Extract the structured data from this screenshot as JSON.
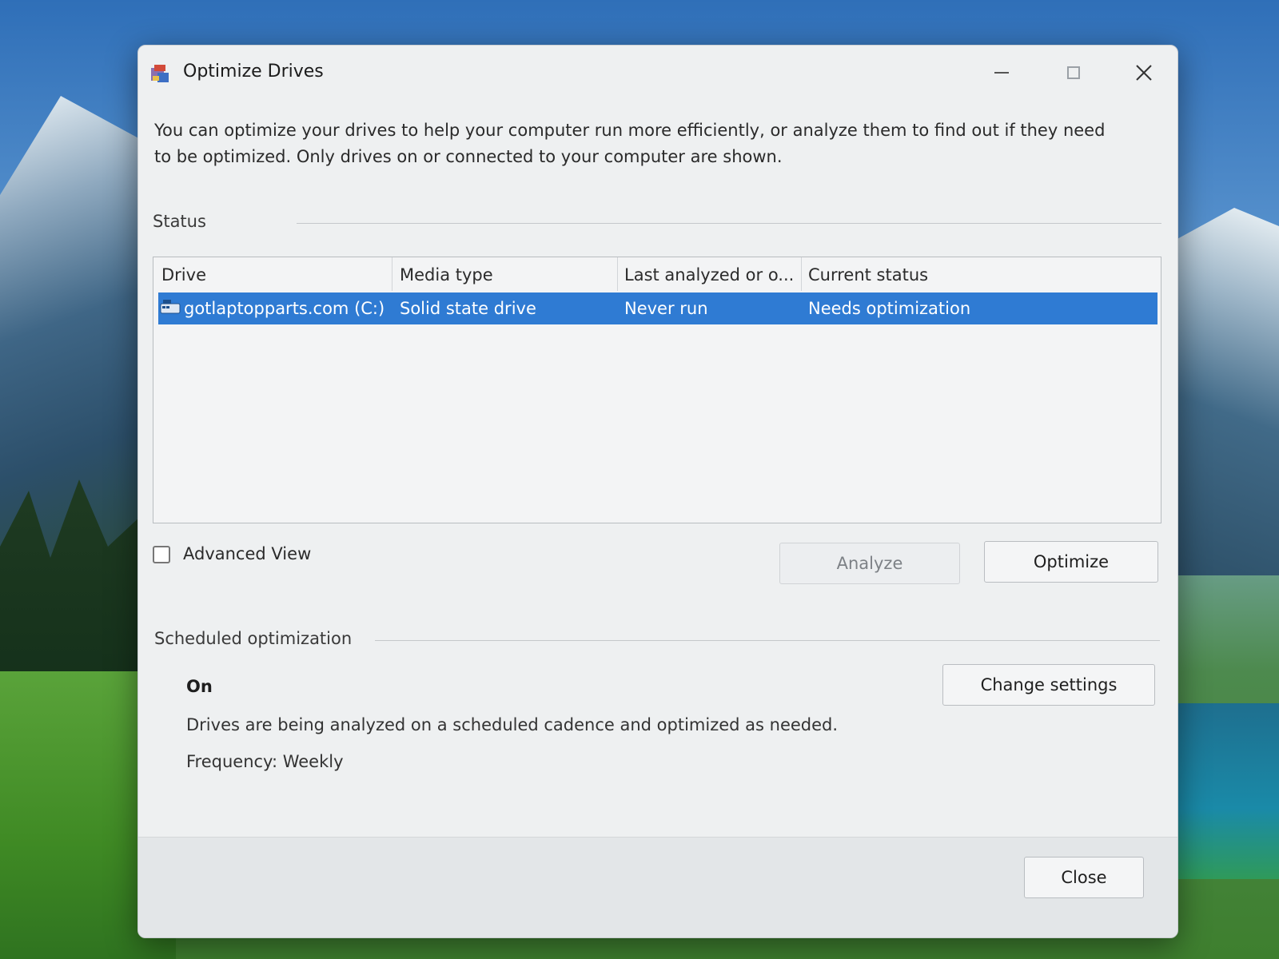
{
  "window": {
    "title": "Optimize Drives",
    "app_icon": "defrag-icon"
  },
  "description": "You can optimize your drives to help your computer run more efficiently, or analyze them to find out if they need to be optimized. Only drives on or connected to your computer are shown.",
  "status": {
    "section_label": "Status",
    "columns": [
      "Drive",
      "Media type",
      "Last analyzed or o...",
      "Current status"
    ],
    "rows": [
      {
        "drive": "gotlaptopparts.com (C:)",
        "media_type": "Solid state drive",
        "last_analyzed": "Never run",
        "current_status": "Needs optimization",
        "icon": "drive-icon",
        "selected": true
      }
    ],
    "selection_color": "#2f7bd3"
  },
  "advanced_view": {
    "label": "Advanced View",
    "checked": false
  },
  "buttons": {
    "analyze": "Analyze",
    "optimize": "Optimize",
    "change_settings": "Change settings",
    "close": "Close"
  },
  "scheduled": {
    "section_label": "Scheduled optimization",
    "state": "On",
    "description": "Drives are being analyzed on a scheduled cadence and optimized as needed.",
    "frequency": "Frequency: Weekly"
  }
}
